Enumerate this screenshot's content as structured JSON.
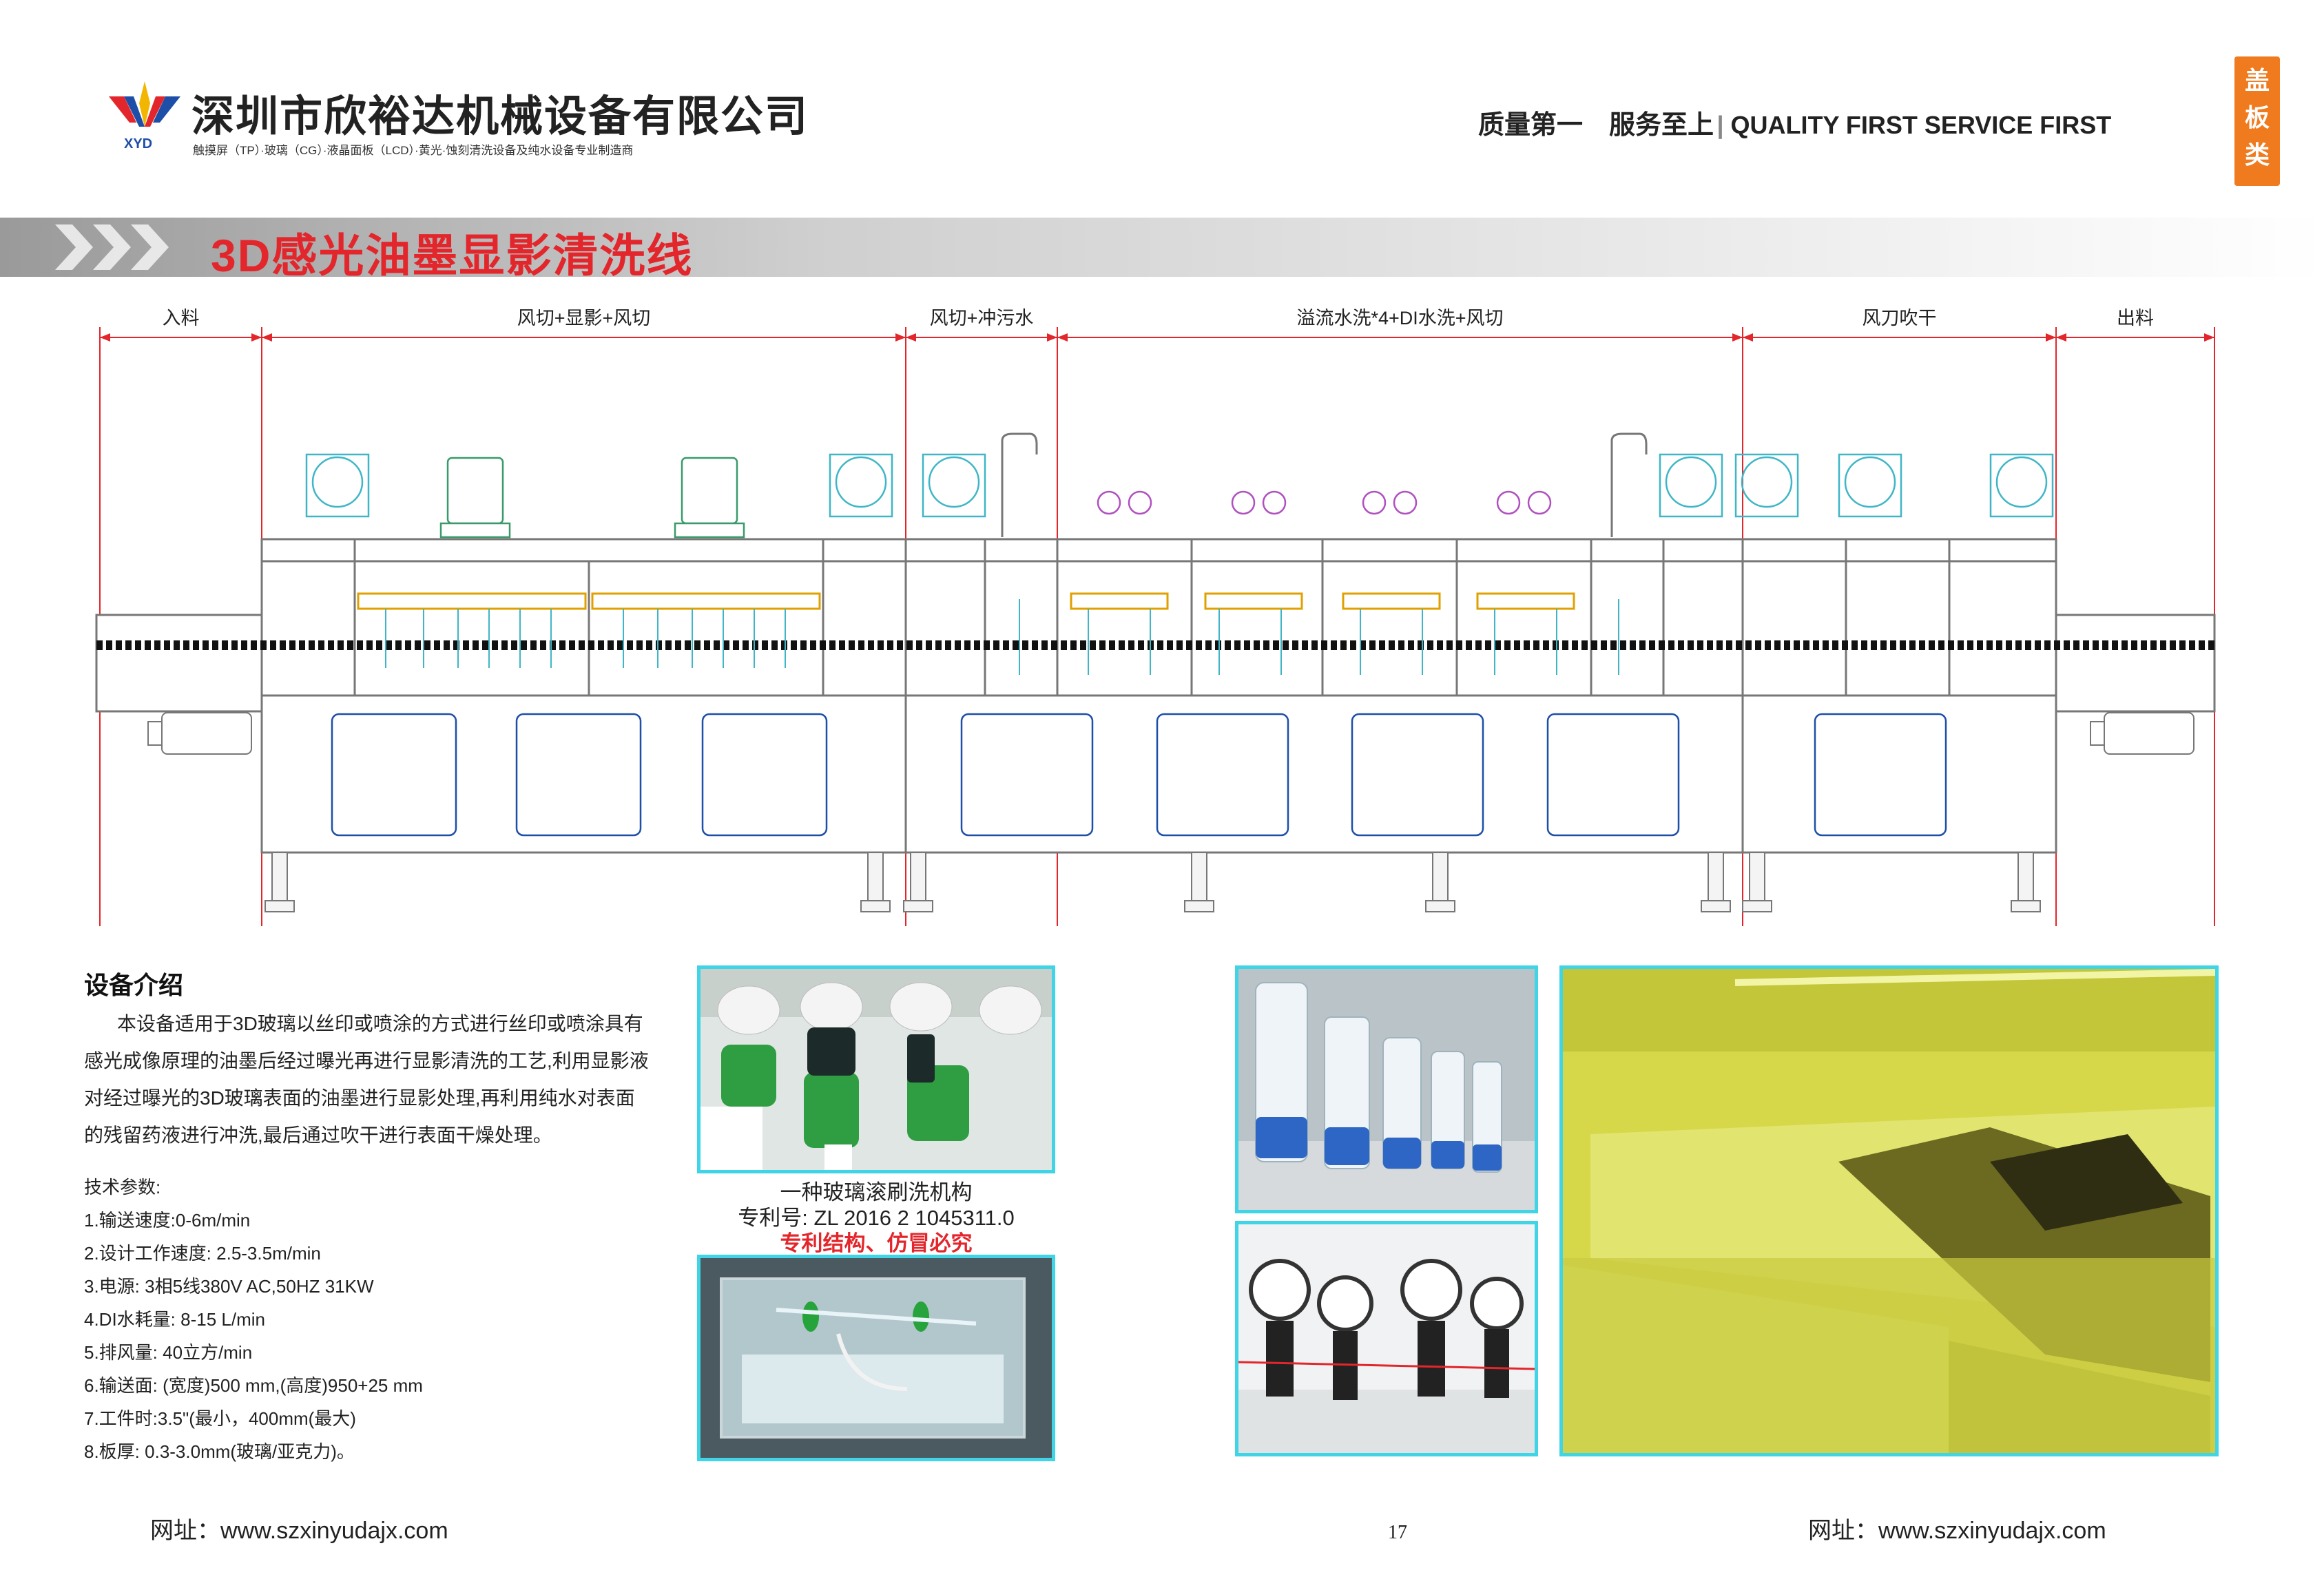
{
  "header": {
    "company_name": "深圳市欣裕达机械设备有限公司",
    "logo_abbr": "XYD",
    "tagline": "触摸屏（TP）·玻璃（CG）·液晶面板（LCD）·黄光·蚀刻清洗设备及纯水设备专业制造商",
    "slogan_cn": "质量第一　服务至上",
    "slogan_en": "QUALITY FIRST SERVICE FIRST",
    "category_tab": [
      "盖",
      "板",
      "类"
    ]
  },
  "page_title": "3D感光油墨显影清洗线",
  "diagram": {
    "sections": [
      {
        "label": "入料"
      },
      {
        "label": "风切+显影+风切"
      },
      {
        "label": "风切+冲污水"
      },
      {
        "label": "溢流水洗*4+DI水洗+风切"
      },
      {
        "label": "风刀吹干"
      },
      {
        "label": "出料"
      }
    ]
  },
  "intro": {
    "heading": "设备介绍",
    "paragraph_lines": [
      "本设备适用于3D玻璃以丝印或喷涂的方式进行丝印或喷涂具有",
      "感光成像原理的油墨后经过曝光再进行显影清洗的工艺,利用显影液",
      "对经过曝光的3D玻璃表面的油墨进行显影处理,再利用纯水对表面",
      "的残留药液进行冲洗,最后通过吹干进行表面干燥处理。"
    ],
    "specs_heading": "技术参数:",
    "specs": [
      "1.输送速度:0-6m/min",
      "2.设计工作速度: 2.5-3.5m/min",
      "3.电源: 3相5线380V AC,50HZ  31KW",
      "4.DI水耗量: 8-15 L/min",
      "5.排风量: 40立方/min",
      "6.输送面: (宽度)500 mm,(高度)950+25 mm",
      "7.工件时:3.5\"(最小，400mm(最大)",
      "8.板厚: 0.3-3.0mm(玻璃/亚克力)。"
    ]
  },
  "patent": {
    "caption": "一种玻璃滚刷洗机构",
    "number": "专利号:  ZL 2016 2 1045311.0",
    "warning": "专利结构、仿冒必究"
  },
  "footer": {
    "website_left": "网址：www.szxinyudajx.com",
    "website_right": "网址：www.szxinyudajx.com",
    "page_number": "17"
  },
  "colors": {
    "accent_red": "#e3262b",
    "frame_cyan": "#3fd4e6",
    "tab_orange": "#f07b1e"
  }
}
